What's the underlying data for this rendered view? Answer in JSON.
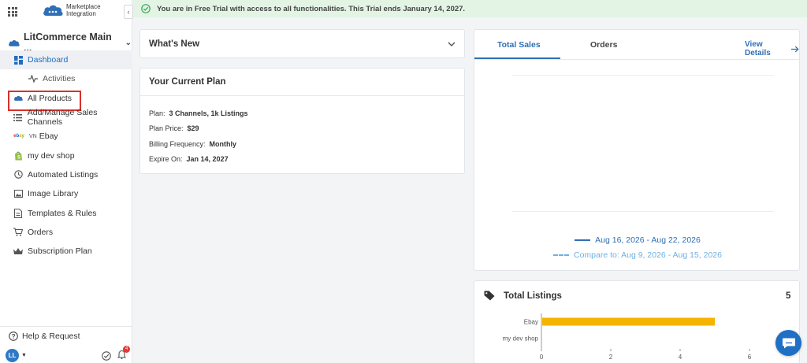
{
  "sidebar": {
    "logo_text": "Marketplace Integration",
    "collapse_glyph": "‹",
    "store_name": "LitCommerce Main ...",
    "items": [
      {
        "label": "Dashboard",
        "icon": "dashboard-icon"
      },
      {
        "label": "Activities",
        "icon": "activity-icon"
      },
      {
        "label": "All Products",
        "icon": "cloud-icon"
      },
      {
        "label": "Add/Manage Sales Channels",
        "icon": "list-icon"
      },
      {
        "label": "Ebay",
        "prefix": "VN",
        "icon": "ebay-icon"
      },
      {
        "label": "my dev shop",
        "icon": "shopify-icon"
      },
      {
        "label": "Automated Listings",
        "icon": "clock-icon"
      },
      {
        "label": "Image Library",
        "icon": "image-icon"
      },
      {
        "label": "Templates & Rules",
        "icon": "document-icon"
      },
      {
        "label": "Orders",
        "icon": "cart-icon"
      },
      {
        "label": "Subscription Plan",
        "icon": "crown-icon"
      }
    ],
    "help_label": "Help & Request",
    "user_initials": "LL",
    "notification_count": "4"
  },
  "trial_banner": {
    "text": "You are in Free Trial with access to all functionalities. This Trial ends January 14, 2027.",
    "color": "#e3f4e5"
  },
  "whats_new": {
    "title": "What's New"
  },
  "plan": {
    "title": "Your Current Plan",
    "rows": [
      {
        "label": "Plan:",
        "value": "3 Channels, 1k Listings"
      },
      {
        "label": "Plan Price:",
        "value": "$29"
      },
      {
        "label": "Billing Frequency:",
        "value": "Monthly"
      },
      {
        "label": "Expire On:",
        "value": "Jan 14, 2027"
      }
    ]
  },
  "sales": {
    "tabs": [
      "Total Sales",
      "Orders"
    ],
    "active_tab": "Total Sales",
    "view_details": "View Details",
    "legend_current": "Aug 16, 2026 - Aug 22, 2026",
    "legend_compare": "Compare to: Aug 9, 2026 - Aug 15, 2026"
  },
  "listings": {
    "title": "Total Listings",
    "count": "5"
  },
  "colors": {
    "accent": "#2f6fb5",
    "bar": "#f5b400",
    "highlight_border": "#d9302a"
  },
  "chart_data": {
    "type": "bar",
    "orientation": "horizontal",
    "categories": [
      "Ebay",
      "my dev shop"
    ],
    "values": [
      5,
      0
    ],
    "xlim": [
      0,
      7
    ],
    "xticks": [
      "0",
      "2",
      "4",
      "6"
    ]
  }
}
